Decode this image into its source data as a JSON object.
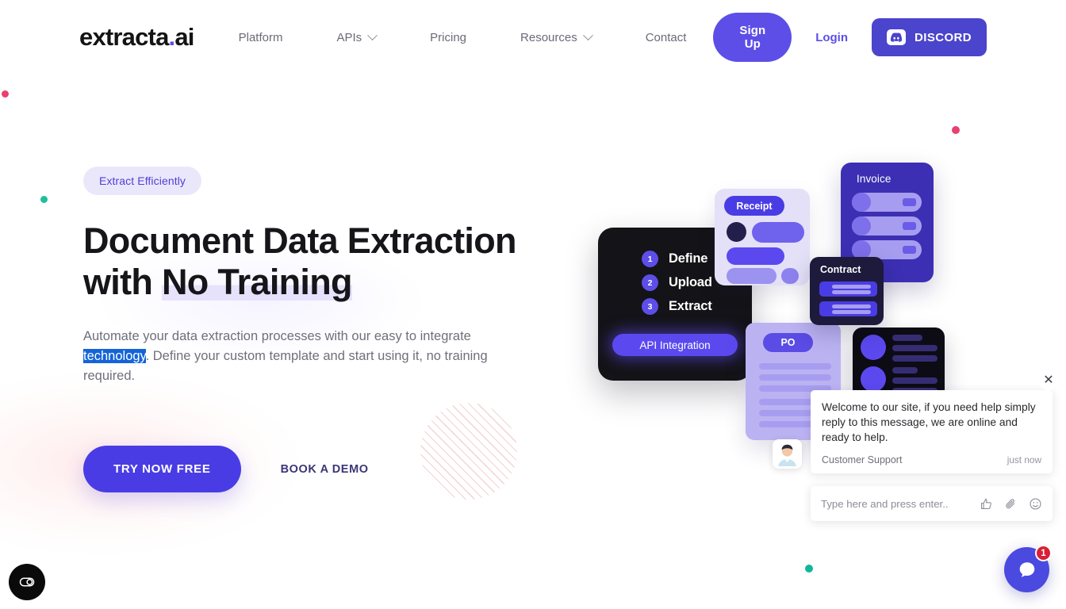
{
  "header": {
    "logo_main": "extracta",
    "logo_dot": ".",
    "logo_suffix": "ai",
    "nav_items": [
      {
        "label": "Platform",
        "has_caret": false
      },
      {
        "label": "APIs",
        "has_caret": true
      },
      {
        "label": "Pricing",
        "has_caret": false
      },
      {
        "label": "Resources",
        "has_caret": true
      },
      {
        "label": "Contact",
        "has_caret": false
      }
    ],
    "signup_label": "Sign Up",
    "login_label": "Login",
    "discord_label": "DISCORD"
  },
  "hero": {
    "badge": "Extract Efficiently",
    "title_line1": "Document Data Extraction",
    "title_line2_pre": "with ",
    "title_line2_highlight": "No Training",
    "sub_part1": "Automate your data extraction processes with our easy to integrate ",
    "sub_selected": "technology",
    "sub_part2": ". Define your custom template and start using it, no training required.",
    "cta_primary": "TRY NOW FREE",
    "cta_secondary": "BOOK A DEMO"
  },
  "illustration": {
    "steps_card": {
      "steps": [
        {
          "num": "1",
          "label": "Define"
        },
        {
          "num": "2",
          "label": "Upload"
        },
        {
          "num": "3",
          "label": "Extract"
        }
      ],
      "api_button": "API Integration"
    },
    "receipt_card_title": "Receipt",
    "invoice_card_title": "Invoice",
    "contract_card_title": "Contract",
    "po_card_title": "PO"
  },
  "chat": {
    "message": "Welcome to our site, if you need help simply reply to this message, we are online and ready to help.",
    "author": "Customer Support",
    "time": "just now",
    "input_placeholder": "Type here and press enter..",
    "close_icon": "✕",
    "badge_count": "1",
    "icons": [
      "thumbs-up-icon",
      "paperclip-icon",
      "emoji-icon"
    ]
  },
  "accessibility": {
    "icon": "accessibility-toggle-icon"
  },
  "colors": {
    "brand_purple": "#5d4ee8",
    "cta_purple": "#4a3ce4",
    "discord_purple": "#4b44cc",
    "badge_bg": "#ebe7fb",
    "badge_text": "#4e3fd6",
    "selection_blue": "#1464d8",
    "dot_pink": "#e8406f",
    "dot_teal": "#0fb79a",
    "chat_badge_red": "#d81f35",
    "dark_card": "#141317",
    "contract_navy": "#1d1a3c",
    "invoice_purple": "#3c2fb3",
    "receipt_lavender": "#e4e0f7",
    "po_lavender": "#bbb2f2"
  }
}
